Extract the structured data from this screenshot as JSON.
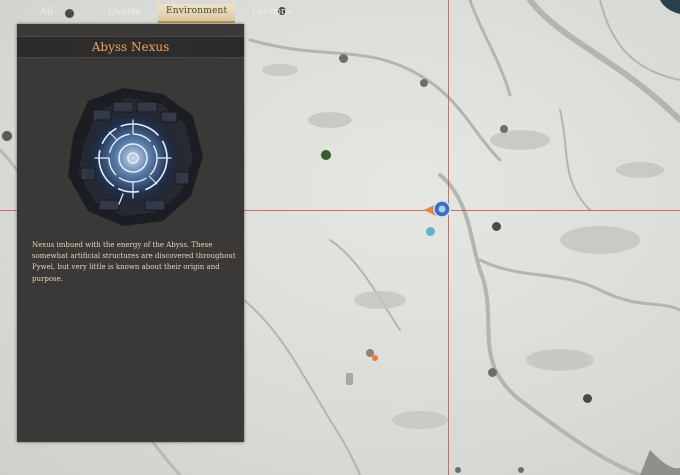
{
  "filter_tabs": {
    "all": "All",
    "quests": "Quests",
    "environment": "Environment",
    "factions": "Factions",
    "active": "Environment"
  },
  "info_panel": {
    "title": "Abyss Nexus",
    "description": "Nexus imbued with the energy of the Abyss. These somewhat artificial structures are discovered throughout Pywel, but very little is known about their origin and purpose."
  },
  "colors": {
    "title_accent": "#eba264",
    "crosshair": "#d2463c",
    "panel_bg": "#3b3937",
    "description_text": "#e4d5b5",
    "nexus_glow": "#7fb8ff"
  },
  "icons": {
    "panel_art": "abyss-nexus-portal",
    "selected_marker": "abyss-nexus-marker",
    "player_pointer": "orange-arrow"
  }
}
